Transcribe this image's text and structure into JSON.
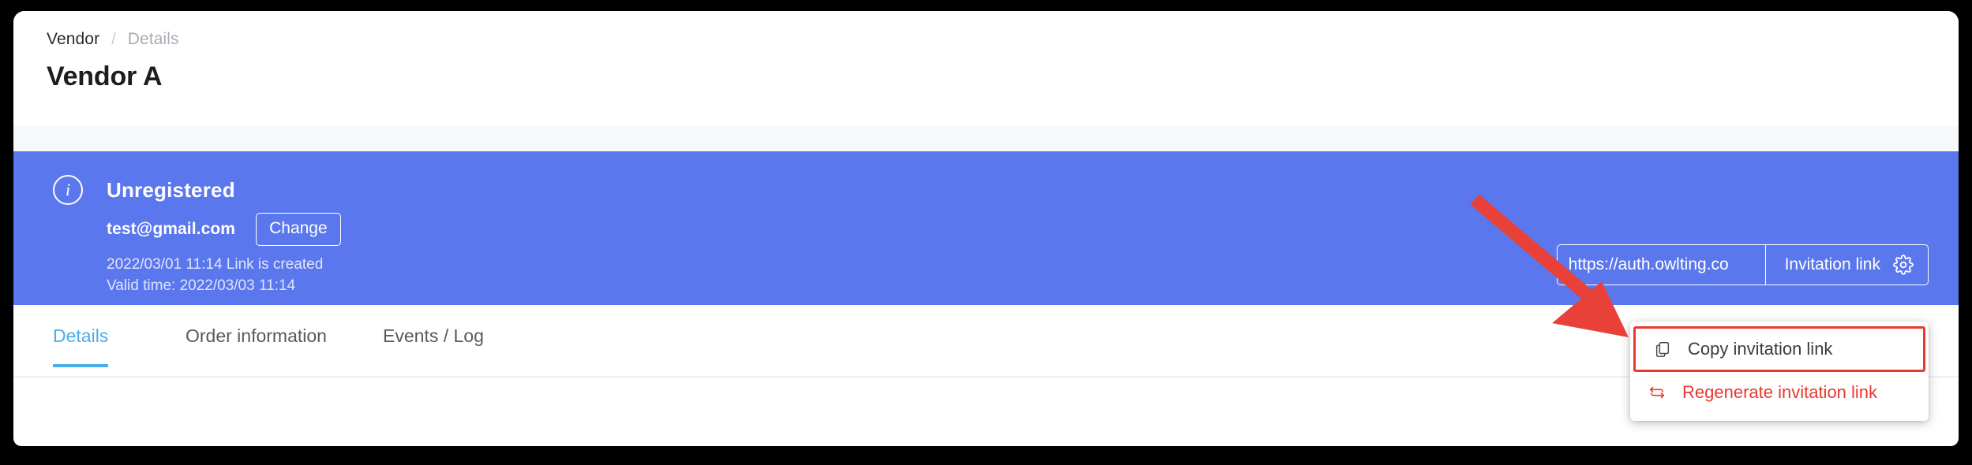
{
  "breadcrumb": {
    "root": "Vendor",
    "separator": "/",
    "current": "Details"
  },
  "page_title": "Vendor A",
  "banner": {
    "icon": "info-circle-icon",
    "status": "Unregistered",
    "email": "test@gmail.com",
    "change_label": "Change",
    "created_line": "2022/03/01 11:14 Link is created",
    "valid_line": "Valid time: 2022/03/03 11:14",
    "link_value": "https://auth.owlting.co",
    "invitation_button_label": "Invitation link",
    "gear_icon": "gear-icon",
    "background_color": "#5b77ee"
  },
  "dropdown": {
    "items": [
      {
        "label": "Copy invitation link",
        "icon": "copy-icon",
        "color": "#3c3c3c",
        "highlighted": true
      },
      {
        "label": "Regenerate invitation link",
        "icon": "refresh-loop-icon",
        "color": "#e8382f",
        "highlighted": false
      }
    ],
    "highlight_color": "#e8382f"
  },
  "tabs": [
    {
      "label": "Details",
      "active": true
    },
    {
      "label": "Order information",
      "active": false
    },
    {
      "label": "Events / Log",
      "active": false
    }
  ],
  "colors": {
    "accent_blue": "#5b77ee",
    "tab_active": "#4aaee8",
    "danger_red": "#e8382f",
    "annotation_arrow": "#e8413a"
  }
}
